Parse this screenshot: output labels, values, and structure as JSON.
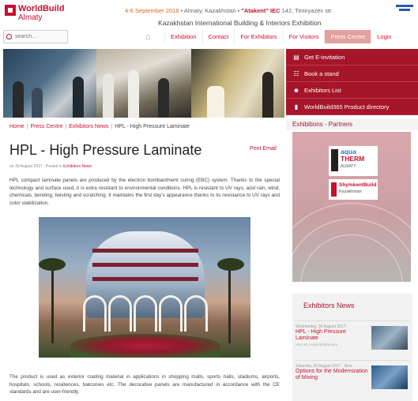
{
  "header": {
    "logo_name": "WorldBuild",
    "logo_sub": "Almaty",
    "event_date": "4-6 September 2018",
    "event_place": " • Almaty, Kazakhstan • ",
    "event_venue": "\"Atakent\" IEC",
    "event_address": " 142, Timiryazev str.",
    "event_title": "Kazakhstan International Building & Interiors Exhibition"
  },
  "search": {
    "placeholder": "search..."
  },
  "nav": {
    "items": [
      {
        "label": "Exhibition"
      },
      {
        "label": "Contact"
      },
      {
        "label": "For Exhibitors"
      },
      {
        "label": "For Visitors"
      },
      {
        "label": "Press Centre"
      },
      {
        "label": "Login"
      }
    ]
  },
  "sidebar": {
    "buttons": [
      {
        "label": "Get E-invitation",
        "icon": "ticket-icon"
      },
      {
        "label": "Book a stand",
        "icon": "grid-icon"
      },
      {
        "label": "Exhibitors List",
        "icon": "users-icon"
      },
      {
        "label": "WorldBuild365 Product directory",
        "icon": "book-icon"
      }
    ],
    "partners_title": "Exhibitions - Partners",
    "partners": [
      {
        "line1": "aqua",
        "line2": "THERM",
        "line3": "ALMATY"
      },
      {
        "line1": "ShymkentBuild",
        "line2": "Kazakhstan"
      }
    ],
    "news_title": "Exhibitors News",
    "news": [
      {
        "date": "Wednesday, 30 August 2017 -",
        "title": "HPL - High Pressure Laminate",
        "meta": "Hits: 83 | Aliya Mukhanova"
      },
      {
        "date": "Saturday, 26 August 2017 - New",
        "title": "Options for the Modernization of Mixing"
      }
    ]
  },
  "breadcrumb": {
    "items": [
      "Home",
      "Press Centre",
      "Exhibitors News"
    ],
    "current": "HPL - High Pressure Laminate"
  },
  "article": {
    "title": "HPL - High Pressure Laminate",
    "print_email": "Print Email",
    "date_text": "on 30 August 2017 . Posted in ",
    "category": "Exhibitors News",
    "para1": "HPL compact laminate panels are produced by the electron bombardment curing (EBC) system. Thanks to the special technology and surface used, it is extra resistant to environmental conditions. HPL is resistant to UV rays, acid rain, wind, chemicals, bending, twisting and scratching. It maintains the first day's appearance thanks to its resistance to UV rays and color stabilization.",
    "para2": "The product is used as exterior coating material in applications in shopping malls, sports halls, stadiums, airports, hospitals, schools, residences, balconies etc. The decorative panels are manufactured in accordance with the CE standards and are user-friendly."
  }
}
